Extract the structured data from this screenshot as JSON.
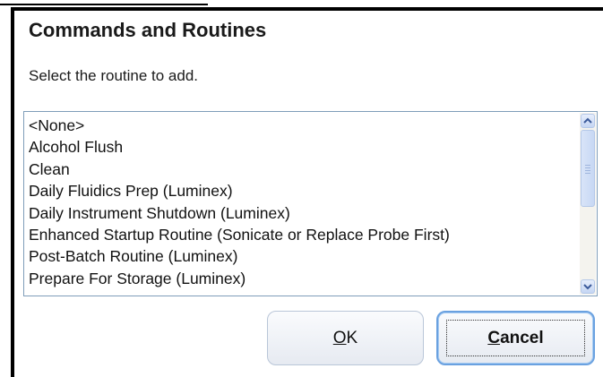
{
  "dialog": {
    "title": "Commands and Routines",
    "prompt": "Select the routine to add."
  },
  "routines": [
    "<None>",
    "Alcohol Flush",
    "Clean",
    "Daily Fluidics Prep (Luminex)",
    "Daily Instrument Shutdown (Luminex)",
    "Enhanced Startup Routine (Sonicate or Replace Probe First)",
    "Post-Batch Routine (Luminex)",
    "Prepare For Storage (Luminex)"
  ],
  "buttons": {
    "ok": {
      "accel": "O",
      "rest": "K"
    },
    "cancel": {
      "accel": "C",
      "rest": "ancel"
    }
  },
  "icons": {
    "scroll_up": "chevron-up-icon",
    "scroll_down": "chevron-down-icon"
  },
  "colors": {
    "listbox_border": "#7f9db9",
    "default_button_border": "#6aa1e0",
    "scrollbar_button": "#c4d5f3"
  }
}
